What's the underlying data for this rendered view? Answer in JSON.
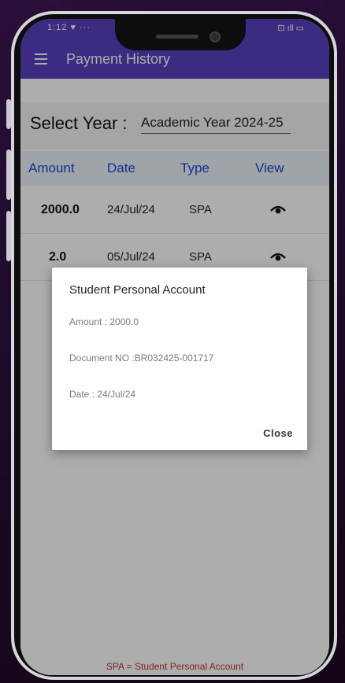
{
  "status_bar": {
    "time": "1:12 ♥ ···",
    "indicators": "⊡ ıll ▭"
  },
  "app_bar": {
    "title": "Payment History",
    "menu_icon": "menu-icon"
  },
  "year_selector": {
    "label": "Select Year :",
    "value": "Academic Year 2024-25"
  },
  "table": {
    "headers": [
      "Amount",
      "Date",
      "Type",
      "View"
    ],
    "rows": [
      {
        "amount": "2000.0",
        "date": "24/Jul/24",
        "type": "SPA",
        "view_icon": "eye-icon"
      },
      {
        "amount": "2.0",
        "date": "05/Jul/24",
        "type": "SPA",
        "view_icon": "eye-icon"
      }
    ]
  },
  "footnote": "SPA = Student Personal Account",
  "dialog": {
    "title": "Student Personal Account",
    "amount": "Amount : 2000.0",
    "document_no": "Document NO :BR032425-001717",
    "date": "Date : 24/Jul/24",
    "close_label": "Close"
  },
  "colors": {
    "app_bar": "#5a3fbf",
    "header_text": "#1a44d6",
    "footnote": "#c0392b"
  }
}
